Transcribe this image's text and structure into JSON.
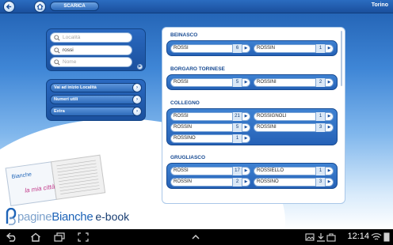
{
  "topbar": {
    "back_icon": "back-arrow-icon",
    "home_icon": "home-icon",
    "download_label": "SCARICA",
    "city": "Torino"
  },
  "search": {
    "locality_placeholder": "Località",
    "surname_value": "rossi",
    "name_placeholder": "Nome"
  },
  "menu": {
    "items": [
      {
        "label": "Vai ad inizio Località"
      },
      {
        "label": "Numeri utili"
      },
      {
        "label": "Extra"
      }
    ]
  },
  "results": {
    "groups": [
      {
        "title": "BEINASCO",
        "entries": [
          {
            "name": "ROSSI",
            "count": "6"
          },
          {
            "name": "ROSSIN",
            "count": "1"
          }
        ]
      },
      {
        "title": "BORGARO TORINESE",
        "entries": [
          {
            "name": "ROSSI",
            "count": "5"
          },
          {
            "name": "ROSSINI",
            "count": "2"
          }
        ]
      },
      {
        "title": "COLLEGNO",
        "entries": [
          {
            "name": "ROSSI",
            "count": "21"
          },
          {
            "name": "ROSSIGNOLI",
            "count": "1"
          },
          {
            "name": "ROSSIN",
            "count": "5"
          },
          {
            "name": "ROSSINI",
            "count": "3"
          },
          {
            "name": "ROSSINO",
            "count": "1"
          }
        ]
      },
      {
        "title": "GRUGLIASCO",
        "entries": [
          {
            "name": "ROSSI",
            "count": "17"
          },
          {
            "name": "ROSSIELLO",
            "count": "1"
          },
          {
            "name": "ROSSIN",
            "count": "2"
          },
          {
            "name": "ROSSINO",
            "count": "3"
          }
        ]
      }
    ]
  },
  "branding": {
    "logo_pagine": "pagine",
    "logo_bianche": "Bianche",
    "logo_ebook": "e-book",
    "cover_logo": "Bianche",
    "cover_tagline": "la mia città"
  },
  "statusbar": {
    "time": "12:14"
  },
  "colors": {
    "brand_blue": "#1e64b8",
    "panel_blue": "#2a69c0",
    "title_blue": "#174a92"
  }
}
